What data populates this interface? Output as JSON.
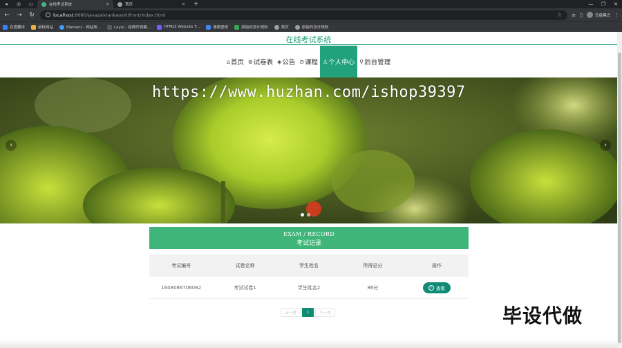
{
  "browser": {
    "tabs": [
      {
        "title": "在线考试系统",
        "active": true
      },
      {
        "title": "首页",
        "active": false
      }
    ],
    "url_host": "localhost",
    "url_path": ":8080/javazaixiankaoshi/front/index.html",
    "profile_label": "无痕模式",
    "bookmarks": [
      "百度翻译",
      "前标网站",
      "Element - 网站快...",
      "Layui - 经典开源模...",
      "HTML5 Website T...",
      "搜索壁纸",
      "原始的设计规则",
      "首页",
      "原始的设计规则"
    ]
  },
  "site": {
    "title": "在线考试系统",
    "accent_color": "#21a17c"
  },
  "nav": {
    "items": [
      {
        "label": "首页",
        "icon": "home-icon",
        "glyph": "⌂"
      },
      {
        "label": "试卷表",
        "icon": "paper-icon",
        "glyph": "⊜"
      },
      {
        "label": "公告",
        "icon": "notice-icon",
        "glyph": "◈"
      },
      {
        "label": "课程",
        "icon": "course-icon",
        "glyph": "⊙"
      },
      {
        "label": "个人中心",
        "icon": "user-icon",
        "glyph": "♙"
      },
      {
        "label": "后台管理",
        "icon": "link-icon",
        "glyph": "⚲"
      }
    ],
    "active_index": 4
  },
  "banner": {
    "watermark": "https://www.huzhan.com/ishop39397",
    "slide_count": 2,
    "active_slide": 0
  },
  "section": {
    "title_en": "EXAM / RECORD",
    "title_cn": "考试记录"
  },
  "table": {
    "headers": [
      "考试编号",
      "试卷名称",
      "学生姓名",
      "所得总分",
      "操作"
    ],
    "rows": [
      {
        "exam_no": "1648086706082",
        "paper": "考试试卷1",
        "student": "学生姓名2",
        "score": "86分",
        "action": "查看"
      }
    ]
  },
  "pager": {
    "prev": "上一页",
    "current": "1",
    "next": "下一页"
  },
  "overlay_text": "毕设代做"
}
